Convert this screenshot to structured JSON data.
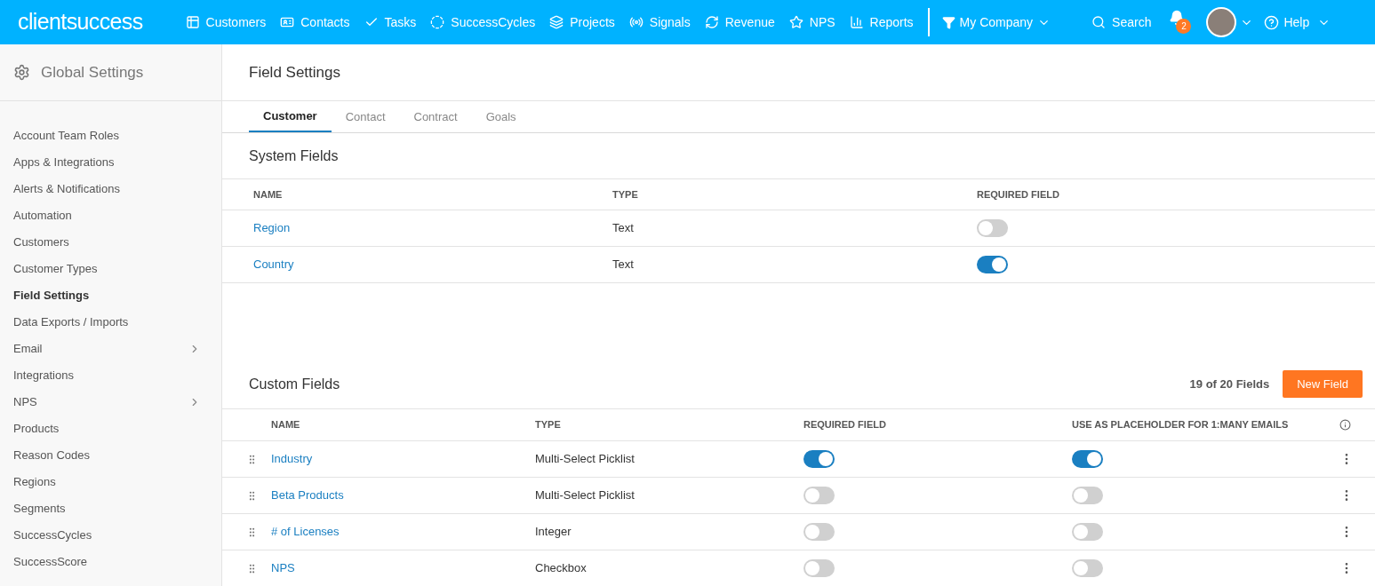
{
  "logo": "client**success**",
  "nav": [
    "Customers",
    "Contacts",
    "Tasks",
    "SuccessCycles",
    "Projects",
    "Signals",
    "Revenue",
    "NPS",
    "Reports"
  ],
  "company_filter": "My Company",
  "search": "Search",
  "notification_count": "2",
  "help": "Help",
  "sidebar": {
    "title": "Global Settings",
    "items": [
      {
        "label": "Account Team Roles",
        "selected": false,
        "expandable": false
      },
      {
        "label": "Apps & Integrations",
        "selected": false,
        "expandable": false
      },
      {
        "label": "Alerts & Notifications",
        "selected": false,
        "expandable": false
      },
      {
        "label": "Automation",
        "selected": false,
        "expandable": false
      },
      {
        "label": "Customers",
        "selected": false,
        "expandable": false
      },
      {
        "label": "Customer Types",
        "selected": false,
        "expandable": false
      },
      {
        "label": "Field Settings",
        "selected": true,
        "expandable": false
      },
      {
        "label": "Data Exports / Imports",
        "selected": false,
        "expandable": false
      },
      {
        "label": "Email",
        "selected": false,
        "expandable": true
      },
      {
        "label": "Integrations",
        "selected": false,
        "expandable": false
      },
      {
        "label": "NPS",
        "selected": false,
        "expandable": true
      },
      {
        "label": "Products",
        "selected": false,
        "expandable": false
      },
      {
        "label": "Reason Codes",
        "selected": false,
        "expandable": false
      },
      {
        "label": "Regions",
        "selected": false,
        "expandable": false
      },
      {
        "label": "Segments",
        "selected": false,
        "expandable": false
      },
      {
        "label": "SuccessCycles",
        "selected": false,
        "expandable": false
      },
      {
        "label": "SuccessScore",
        "selected": false,
        "expandable": false
      }
    ]
  },
  "page_title": "Field Settings",
  "tabs": [
    {
      "label": "Customer",
      "selected": true
    },
    {
      "label": "Contact",
      "selected": false
    },
    {
      "label": "Contract",
      "selected": false
    },
    {
      "label": "Goals",
      "selected": false
    }
  ],
  "system_fields": {
    "title": "System Fields",
    "columns": [
      "NAME",
      "TYPE",
      "REQUIRED FIELD"
    ],
    "rows": [
      {
        "name": "Region",
        "type": "Text",
        "required": false
      },
      {
        "name": "Country",
        "type": "Text",
        "required": true
      }
    ]
  },
  "custom_fields": {
    "title": "Custom Fields",
    "count": "19 of 20 Fields",
    "new_button": "New Field",
    "columns": [
      "NAME",
      "TYPE",
      "REQUIRED FIELD",
      "USE AS PLACEHOLDER FOR 1:MANY EMAILS"
    ],
    "rows": [
      {
        "name": "Industry",
        "type": "Multi-Select Picklist",
        "required": true,
        "placeholder": true
      },
      {
        "name": "Beta Products",
        "type": "Multi-Select Picklist",
        "required": false,
        "placeholder": false
      },
      {
        "name": "# of Licenses",
        "type": "Integer",
        "required": false,
        "placeholder": false
      },
      {
        "name": "NPS",
        "type": "Checkbox",
        "required": false,
        "placeholder": false
      }
    ]
  }
}
